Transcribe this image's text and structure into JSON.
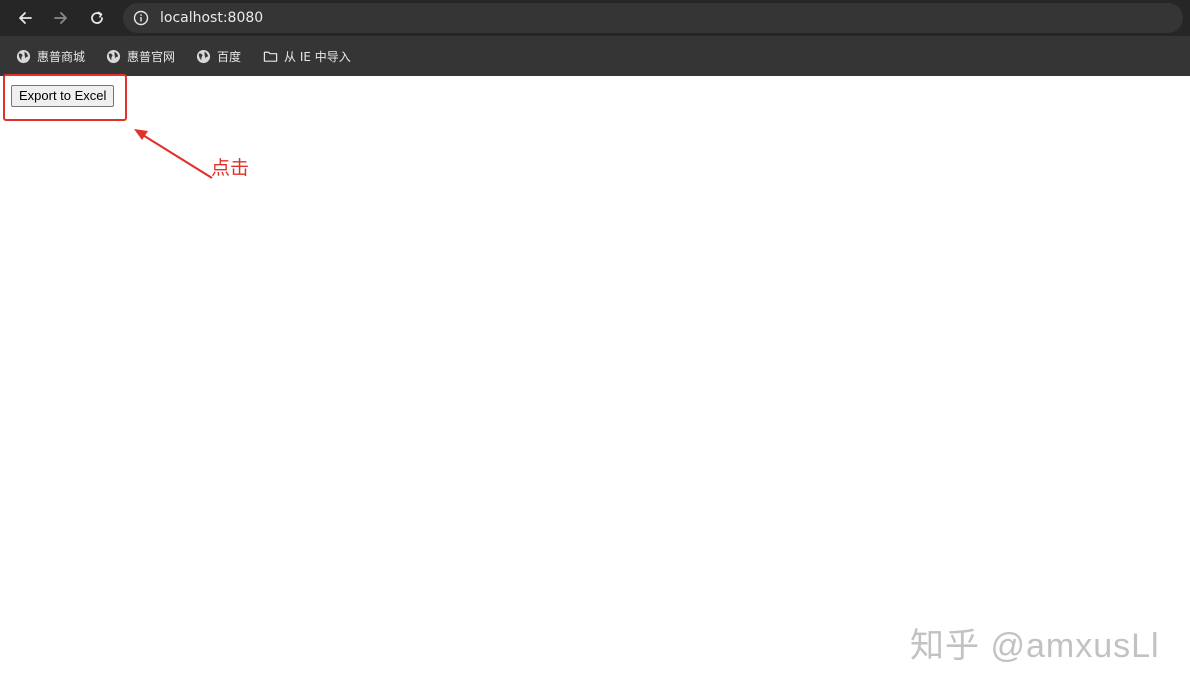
{
  "browser": {
    "url": "localhost:8080",
    "nav": {
      "back_icon": "back-arrow-icon",
      "forward_icon": "forward-arrow-icon",
      "reload_icon": "reload-icon",
      "info_icon": "info-icon"
    },
    "bookmarks": [
      {
        "label": "惠普商城",
        "icon": "globe-icon"
      },
      {
        "label": "惠普官网",
        "icon": "globe-icon"
      },
      {
        "label": "百度",
        "icon": "globe-icon"
      },
      {
        "label": "从 IE 中导入",
        "icon": "folder-icon"
      }
    ]
  },
  "page": {
    "export_button_label": "Export to Excel"
  },
  "annotation": {
    "label": "点击",
    "color": "#e0322b"
  },
  "watermark": {
    "text": "知乎 @amxusLl"
  }
}
